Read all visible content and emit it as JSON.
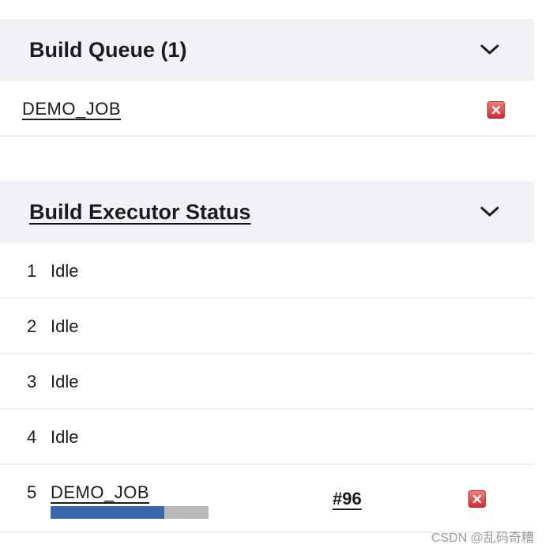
{
  "build_queue": {
    "title": "Build Queue (1)",
    "items": [
      {
        "job_name": "DEMO_JOB"
      }
    ]
  },
  "executor_status": {
    "title": "Build Executor Status",
    "executors": [
      {
        "number": "1",
        "status": "Idle"
      },
      {
        "number": "2",
        "status": "Idle"
      },
      {
        "number": "3",
        "status": "Idle"
      },
      {
        "number": "4",
        "status": "Idle"
      },
      {
        "number": "5",
        "job_name": "DEMO_JOB",
        "build": "#96",
        "progress_fraction": 0.72
      }
    ]
  },
  "icons": {
    "collapse": "chevron-down-icon",
    "cancel": "cancel-x-icon"
  },
  "colors": {
    "header_bg": "#f2f2f6",
    "progress_fill": "#3b68a8",
    "progress_track": "#b8b8b8",
    "cancel_red": "#d22d2d"
  },
  "watermark": "CSDN @乱码奇糟"
}
